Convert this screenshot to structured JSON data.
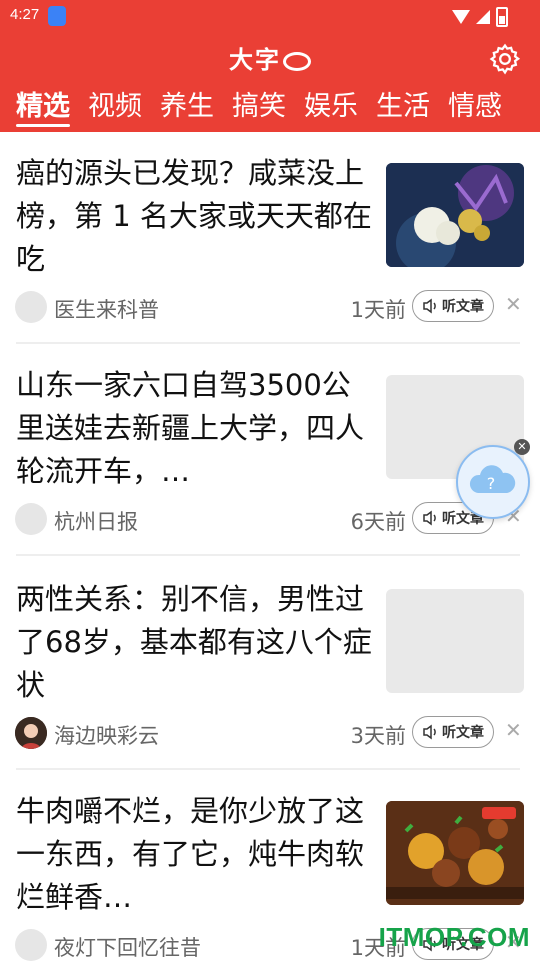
{
  "status": {
    "time": "4:27"
  },
  "header": {
    "logo_text": "大字",
    "accent": "#ea3f35"
  },
  "tabs": [
    {
      "label": "精选",
      "active": true
    },
    {
      "label": "视频"
    },
    {
      "label": "养生"
    },
    {
      "label": "搞笑"
    },
    {
      "label": "娱乐"
    },
    {
      "label": "生活"
    },
    {
      "label": "情感"
    }
  ],
  "feed": [
    {
      "title": "癌的源头已发现？咸菜没上榜，第 1 名大家或天天都在吃",
      "author": "医生来科普",
      "time_ago": "1天前",
      "listen_label": "听文章",
      "thumb": "virus-illustration"
    },
    {
      "title": "山东一家六口自驾3500公里送娃去新疆上大学，四人轮流开车，…",
      "author": "杭州日报",
      "time_ago": "6天前",
      "listen_label": "听文章",
      "thumb": "placeholder"
    },
    {
      "title": "两性关系：别不信，男性过了68岁，基本都有这八个症状",
      "author": "海边映彩云",
      "time_ago": "3天前",
      "listen_label": "听文章",
      "thumb": "placeholder"
    },
    {
      "title": "牛肉嚼不烂，是你少放了这一东西，有了它，炖牛肉软烂鲜香…",
      "author": "夜灯下回忆往昔",
      "time_ago": "1天前",
      "listen_label": "听文章",
      "thumb": "beef-stew-photo"
    }
  ],
  "floating_help": {
    "icon": "question-cloud-icon"
  },
  "watermark": "ITMOP.COM"
}
